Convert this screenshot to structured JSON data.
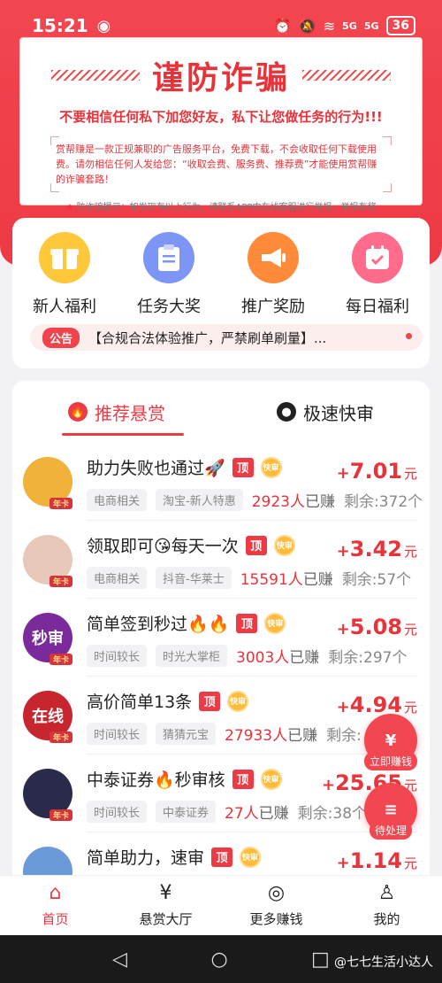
{
  "status": {
    "time": "15:21",
    "battery": "36",
    "sig1": "5G",
    "sig2": "5G"
  },
  "warning": {
    "title": "谨防诈骗",
    "subtitle": "不要相信任何私下加您好友，私下让您做任务的行为!!!",
    "body": "赏帮赚是一款正规兼职的广告服务平台，免费下载，不会收取任何下载使用费。请勿相信任何人发给您：“收取会费、服务费、推荐费”才能使用赏帮赚的诈骗套路！",
    "tip": "防诈骗提示：如发现有以上行为，请联系APP内在线客服进行举报，举报有奖"
  },
  "features": [
    {
      "label": "新人福利",
      "icon": "gift-icon",
      "color": "#ffc83a"
    },
    {
      "label": "任务大奖",
      "icon": "clipboard-icon",
      "color": "#7d95f5"
    },
    {
      "label": "推广奖励",
      "icon": "megaphone-icon",
      "color": "#ff8a3a"
    },
    {
      "label": "每日福利",
      "icon": "calendar-icon",
      "color": "#ff6b8a"
    }
  ],
  "notice": {
    "tag": "公告",
    "text": "【合规合法体验推广，严禁刷单刷量】..."
  },
  "tabs": [
    {
      "label": "推荐悬赏",
      "icon": "fire-icon"
    },
    {
      "label": "极速快审",
      "icon": "user-icon"
    }
  ],
  "badges": {
    "top": "顶",
    "fast": "快审",
    "annual": "年卡"
  },
  "tasks": [
    {
      "title": "助力失败也通过🚀",
      "tags": [
        "电商相关",
        "淘宝-新人特惠"
      ],
      "earned_num": "2923人",
      "earned_suffix": "已赚",
      "remain": "剩余:372个",
      "price": "7.01",
      "avatar_color": "#f0b23a"
    },
    {
      "title": "领取即可😘每天一次",
      "tags": [
        "电商相关",
        "抖音-华莱士"
      ],
      "earned_num": "15591人",
      "earned_suffix": "已赚",
      "remain": "剩余:57个",
      "price": "3.42",
      "avatar_color": "#e8c8b8"
    },
    {
      "title": "简单签到秒过🔥🔥",
      "tags": [
        "时间较长",
        "时光大掌柜"
      ],
      "earned_num": "3003人",
      "earned_suffix": "已赚",
      "remain": "剩余:297个",
      "price": "5.08",
      "avatar_color": "#7a2a9a",
      "avatar_text": "秒审"
    },
    {
      "title": "高价简单13条",
      "tags": [
        "时间较长",
        "猜猜元宝"
      ],
      "earned_num": "27933人",
      "earned_suffix": "已赚",
      "remain": "剩余:",
      "price": "4.94",
      "avatar_color": "#c8262e",
      "avatar_text": "在线"
    },
    {
      "title": "中泰证券🔥秒审核",
      "tags": [
        "时间较长",
        "中泰证券"
      ],
      "earned_num": "27人",
      "earned_suffix": "已赚",
      "remain": "剩余:38个",
      "price": "25.65",
      "avatar_color": "#2a2a4a"
    },
    {
      "title": "简单助力，速审",
      "tags": [],
      "earned_num": "",
      "earned_suffix": "",
      "remain": "",
      "price": "1.14",
      "avatar_color": "#6a9ad8"
    }
  ],
  "price_plus": "+",
  "price_unit": "元",
  "floats": {
    "earn_icon": "¥",
    "earn_label": "立即赚钱",
    "pending_icon": "≡",
    "pending_label": "待处理"
  },
  "nav": [
    {
      "label": "首页",
      "icon": "home-icon",
      "glyph": "⌂"
    },
    {
      "label": "悬赏大厅",
      "icon": "reward-hall-icon",
      "glyph": "¥"
    },
    {
      "label": "更多赚钱",
      "icon": "gamepad-icon",
      "glyph": "◎"
    },
    {
      "label": "我的",
      "icon": "profile-icon",
      "glyph": "♙"
    }
  ],
  "watermark": "@七七生活小达人"
}
